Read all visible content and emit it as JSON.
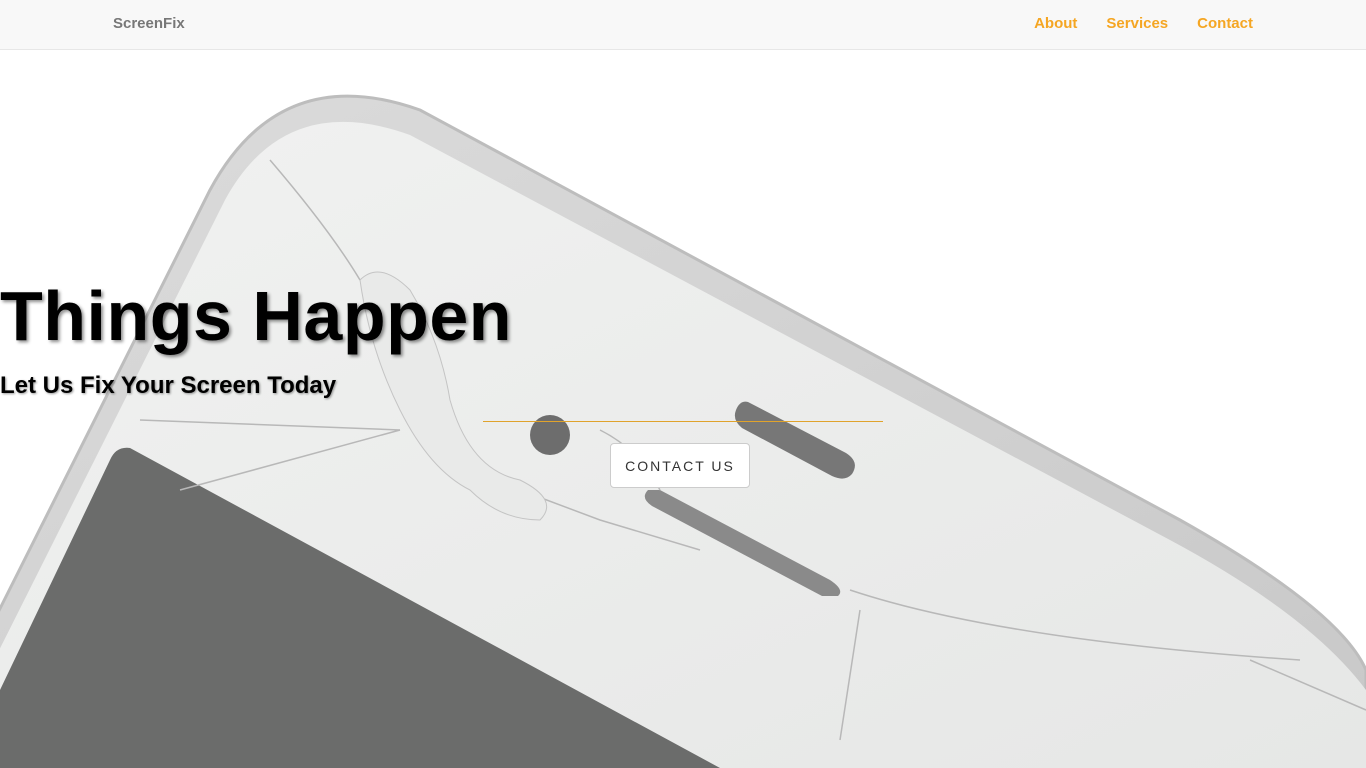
{
  "navbar": {
    "brand": "ScreenFix",
    "links": [
      "About",
      "Services",
      "Contact"
    ],
    "link_color": "#f5a623"
  },
  "hero": {
    "title": "Things Happen",
    "subtitle": "Let Us Fix Your Screen Today",
    "cta_label": "CONTACT US",
    "divider_color": "#e0a32c",
    "background_image": "cracked-phone-screen"
  }
}
